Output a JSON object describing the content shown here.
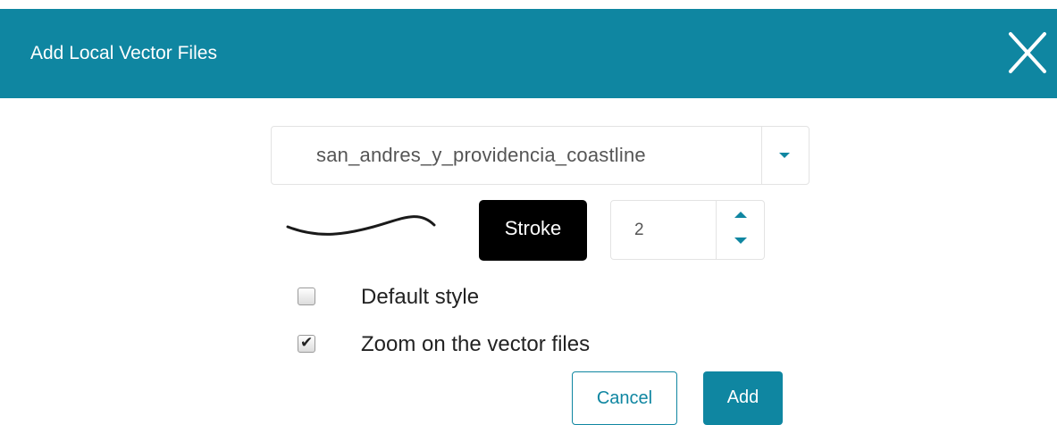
{
  "dialog": {
    "title": "Add Local Vector Files",
    "close_icon": "close-icon",
    "accent_color": "#0f86a1"
  },
  "file_select": {
    "value": "san_andres_y_providencia_coastline",
    "arrow_icon": "chevron-down-icon"
  },
  "style": {
    "stroke_label": "Stroke",
    "stroke_color": "#000000",
    "stroke_width": "2"
  },
  "options": {
    "default_style": {
      "label": "Default style",
      "checked": false
    },
    "zoom_vectors": {
      "label": "Zoom on the vector files",
      "checked": true
    }
  },
  "actions": {
    "cancel_label": "Cancel",
    "add_label": "Add"
  }
}
